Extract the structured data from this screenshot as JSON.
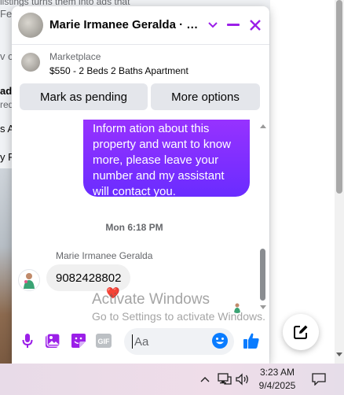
{
  "background": {
    "top_text": "listings turns them into ads that",
    "fragments": [
      "Fee",
      "v c",
      "ad",
      "red",
      "s A",
      "y R"
    ]
  },
  "chat": {
    "title": "Marie Irmanee Geralda · 2 ...",
    "icons": {
      "dropdown": "chevron-down-icon",
      "minimize": "minimize-icon",
      "close": "close-icon"
    },
    "accent_color": "#9b1fe8",
    "marketplace": {
      "label": "Marketplace",
      "listing_title": "$550 - 2 Beds 2 Baths Apartment"
    },
    "actions": {
      "mark_pending": "Mark as pending",
      "more_options": "More options"
    },
    "messages": {
      "outgoing_lines": [
        "Inform      ation about this",
        "property and want to know",
        "more, please leave your",
        "number and my assistant",
        "will contact you."
      ],
      "timestamp": "Mon 6:18 PM",
      "sender_name": "Marie Irmanee Geralda",
      "incoming_text": "9082428802",
      "reaction": "❤️"
    },
    "composer": {
      "placeholder": "Aa",
      "icons": [
        "microphone-icon",
        "photo-icon",
        "sticker-icon",
        "gif-icon",
        "emoji-icon",
        "thumbs-up-icon"
      ],
      "gif_label": "GIF"
    }
  },
  "watermark": {
    "title": "Activate Windows",
    "subtitle": "Go to Settings to activate Windows."
  },
  "new_message_icon": "compose-icon",
  "taskbar": {
    "time": "3:23 AM",
    "date": "9/4/2025"
  }
}
